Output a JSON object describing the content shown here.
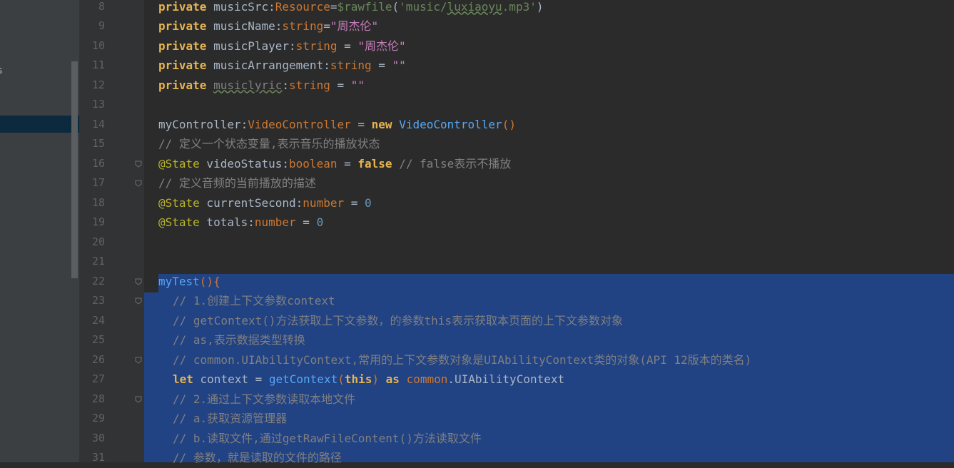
{
  "colors": {
    "editor_bg": "#2b2b2b",
    "gutter_bg": "#313335",
    "sidebar_bg": "#3c3f41",
    "selection": "#214283",
    "keyword": "#cc7832",
    "string": "#6a8759",
    "comment": "#808080",
    "annotation": "#bbb529",
    "function": "#56a8f5",
    "number": "#6897bb"
  },
  "sidebar": {
    "clipped_text": "s"
  },
  "lines": [
    {
      "n": "8",
      "tokens": [
        [
          "kwy",
          "private"
        ],
        [
          "id",
          " musicSrc:"
        ],
        [
          "ty",
          "Resource"
        ],
        [
          "id",
          "="
        ],
        [
          "str",
          "$rawfile"
        ],
        [
          "id",
          "("
        ],
        [
          "str",
          "'music/"
        ],
        [
          "strw",
          "luxiaoyu"
        ],
        [
          "str",
          ".mp3'"
        ],
        [
          "id",
          ")"
        ]
      ]
    },
    {
      "n": "9",
      "tokens": [
        [
          "kwy",
          "private"
        ],
        [
          "id",
          " musicName:"
        ],
        [
          "ty",
          "string"
        ],
        [
          "id",
          "="
        ],
        [
          "strp",
          "\"周杰伦\""
        ]
      ]
    },
    {
      "n": "10",
      "tokens": [
        [
          "kwy",
          "private"
        ],
        [
          "id",
          " musicPlayer:"
        ],
        [
          "ty",
          "string"
        ],
        [
          "id",
          " = "
        ],
        [
          "strp",
          "\"周杰伦\""
        ]
      ]
    },
    {
      "n": "11",
      "tokens": [
        [
          "kwy",
          "private"
        ],
        [
          "id",
          " musicArrangement:"
        ],
        [
          "ty",
          "string"
        ],
        [
          "id",
          " = "
        ],
        [
          "strp",
          "\"\""
        ]
      ]
    },
    {
      "n": "12",
      "tokens": [
        [
          "kwy",
          "private"
        ],
        [
          "id",
          " "
        ],
        [
          "cmw",
          "musiclyric"
        ],
        [
          "id",
          ":"
        ],
        [
          "ty",
          "string"
        ],
        [
          "id",
          " = "
        ],
        [
          "strp",
          "\"\""
        ]
      ]
    },
    {
      "n": "13",
      "tokens": []
    },
    {
      "n": "14",
      "tokens": [
        [
          "id",
          "myController:"
        ],
        [
          "ty",
          "VideoController"
        ],
        [
          "id",
          " = "
        ],
        [
          "kwy",
          "new"
        ],
        [
          "id",
          " "
        ],
        [
          "fnc",
          "VideoController"
        ],
        [
          "ty",
          "()"
        ]
      ]
    },
    {
      "n": "15",
      "tokens": [
        [
          "cm",
          "// 定义一个状态变量,表示音乐的播放状态"
        ]
      ]
    },
    {
      "n": "16",
      "tokens": [
        [
          "ann",
          "@State"
        ],
        [
          "id",
          " videoStatus:"
        ],
        [
          "ty",
          "boolean"
        ],
        [
          "id",
          " = "
        ],
        [
          "kwy",
          "false"
        ],
        [
          "id",
          " "
        ],
        [
          "cm",
          "// false表示不播放"
        ]
      ]
    },
    {
      "n": "17",
      "tokens": [
        [
          "cm",
          "// 定义音频的当前播放的描述"
        ]
      ]
    },
    {
      "n": "18",
      "tokens": [
        [
          "ann",
          "@State"
        ],
        [
          "id",
          " currentSecond:"
        ],
        [
          "ty",
          "number"
        ],
        [
          "id",
          " = "
        ],
        [
          "num",
          "0"
        ]
      ]
    },
    {
      "n": "19",
      "tokens": [
        [
          "ann",
          "@State"
        ],
        [
          "id",
          " totals:"
        ],
        [
          "ty",
          "number"
        ],
        [
          "id",
          " = "
        ],
        [
          "num",
          "0"
        ]
      ]
    },
    {
      "n": "20",
      "tokens": []
    },
    {
      "n": "21",
      "tokens": []
    },
    {
      "n": "22",
      "tokens": [
        [
          "fn",
          "myTest"
        ],
        [
          "ty",
          "(){"
        ]
      ]
    },
    {
      "n": "23",
      "indent": true,
      "tokens": [
        [
          "cm",
          "// 1.创建上下文参数context"
        ]
      ]
    },
    {
      "n": "24",
      "indent": true,
      "tokens": [
        [
          "cm",
          "// getContext()方法获取上下文参数，的参数this表示获取本页面的上下文参数对象"
        ]
      ]
    },
    {
      "n": "25",
      "indent": true,
      "tokens": [
        [
          "cm",
          "// as,表示数据类型转换"
        ]
      ]
    },
    {
      "n": "26",
      "indent": true,
      "tokens": [
        [
          "cm",
          "// common.UIAbilityContext,常用的上下文参数对象是UIAbilityContext类的对象(API 12版本的类名)"
        ]
      ]
    },
    {
      "n": "27",
      "indent": true,
      "tokens": [
        [
          "kwy",
          "let"
        ],
        [
          "id",
          " context = "
        ],
        [
          "fn",
          "getContext"
        ],
        [
          "ty",
          "("
        ],
        [
          "kwy",
          "this"
        ],
        [
          "ty",
          ")"
        ],
        [
          "id",
          " "
        ],
        [
          "kwy",
          "as"
        ],
        [
          "id",
          " "
        ],
        [
          "ty",
          "common"
        ],
        [
          "id",
          ".UIAbilityContext"
        ]
      ]
    },
    {
      "n": "28",
      "indent": true,
      "tokens": [
        [
          "cm",
          "// 2.通过上下文参数读取本地文件"
        ]
      ]
    },
    {
      "n": "29",
      "indent": true,
      "tokens": [
        [
          "cm",
          "// a.获取资源管理器"
        ]
      ]
    },
    {
      "n": "30",
      "indent": true,
      "tokens": [
        [
          "cm",
          "// b.读取文件,通过getRawFileContent()方法读取文件"
        ]
      ]
    },
    {
      "n": "31",
      "indent": true,
      "tokens": [
        [
          "cm",
          "// 参数，就是读取的文件的路径"
        ]
      ]
    }
  ],
  "folds": [
    "16",
    "17",
    "22",
    "23",
    "26",
    "28"
  ],
  "selection_start_line": "22"
}
